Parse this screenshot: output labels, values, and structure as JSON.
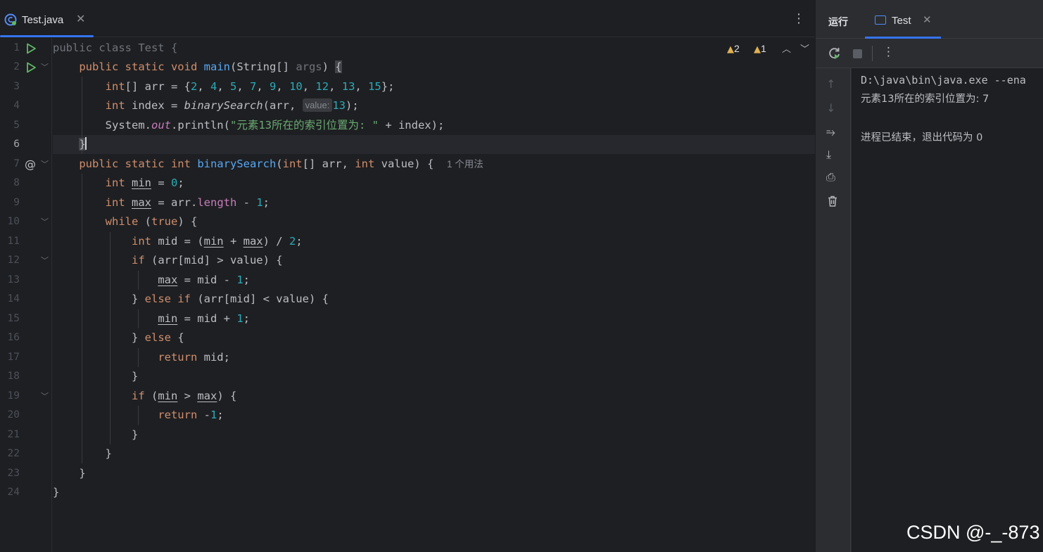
{
  "editor": {
    "tab": {
      "label": "Test.java",
      "close": "✕"
    },
    "more": "⋮",
    "inspections": {
      "warnings": "2",
      "weak_warnings": "1"
    },
    "line_numbers": [
      "1",
      "2",
      "3",
      "4",
      "5",
      "6",
      "7",
      "8",
      "9",
      "10",
      "11",
      "12",
      "13",
      "14",
      "15",
      "16",
      "17",
      "18",
      "19",
      "20",
      "21",
      "22",
      "23",
      "24"
    ],
    "hint_value": "value:",
    "usage_hint": "1 个用法",
    "string_literal": "\"元素13所在的索引位置为: \""
  },
  "run_panel": {
    "title": "运行",
    "tab_label": "Test",
    "tab_close": "✕",
    "console": [
      "D:\\java\\bin\\java.exe --ena",
      "元素13所在的索引位置为: 7",
      "",
      "进程已结束，退出代码为 0"
    ]
  },
  "watermark": "CSDN @-_-873",
  "colors": {
    "accent": "#3574f0",
    "keyword": "#cf8e6d",
    "function": "#56a8f5",
    "number": "#2aacb8",
    "string": "#6aab73"
  }
}
